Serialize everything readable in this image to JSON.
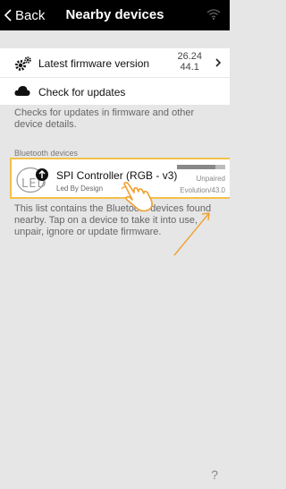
{
  "header": {
    "back_label": "Back",
    "title": "Nearby devices"
  },
  "firmware": {
    "label": "Latest firmware version",
    "version_primary": "26.24",
    "version_secondary": "44.1"
  },
  "check": {
    "label": "Check for updates"
  },
  "description": "Checks for updates in firmware and other device details.",
  "bluetooth": {
    "section_label": "Bluetooth devices",
    "devices": [
      {
        "logo_text": "LED",
        "name": "SPI Controller  (RGB - v3)",
        "maker": "Led By Design",
        "status": "Unpaired",
        "firmware": "Evolution/43.0",
        "signal_fraction": 0.8
      }
    ]
  },
  "hint": "This list contains the Bluetooth devices found nearby. Tap on a device to take it into use, unpair, ignore or update firmware.",
  "help_label": "?",
  "colors": {
    "header_bg": "#000000",
    "highlight_border": "#f4c04a",
    "annotation": "#f0a030"
  }
}
